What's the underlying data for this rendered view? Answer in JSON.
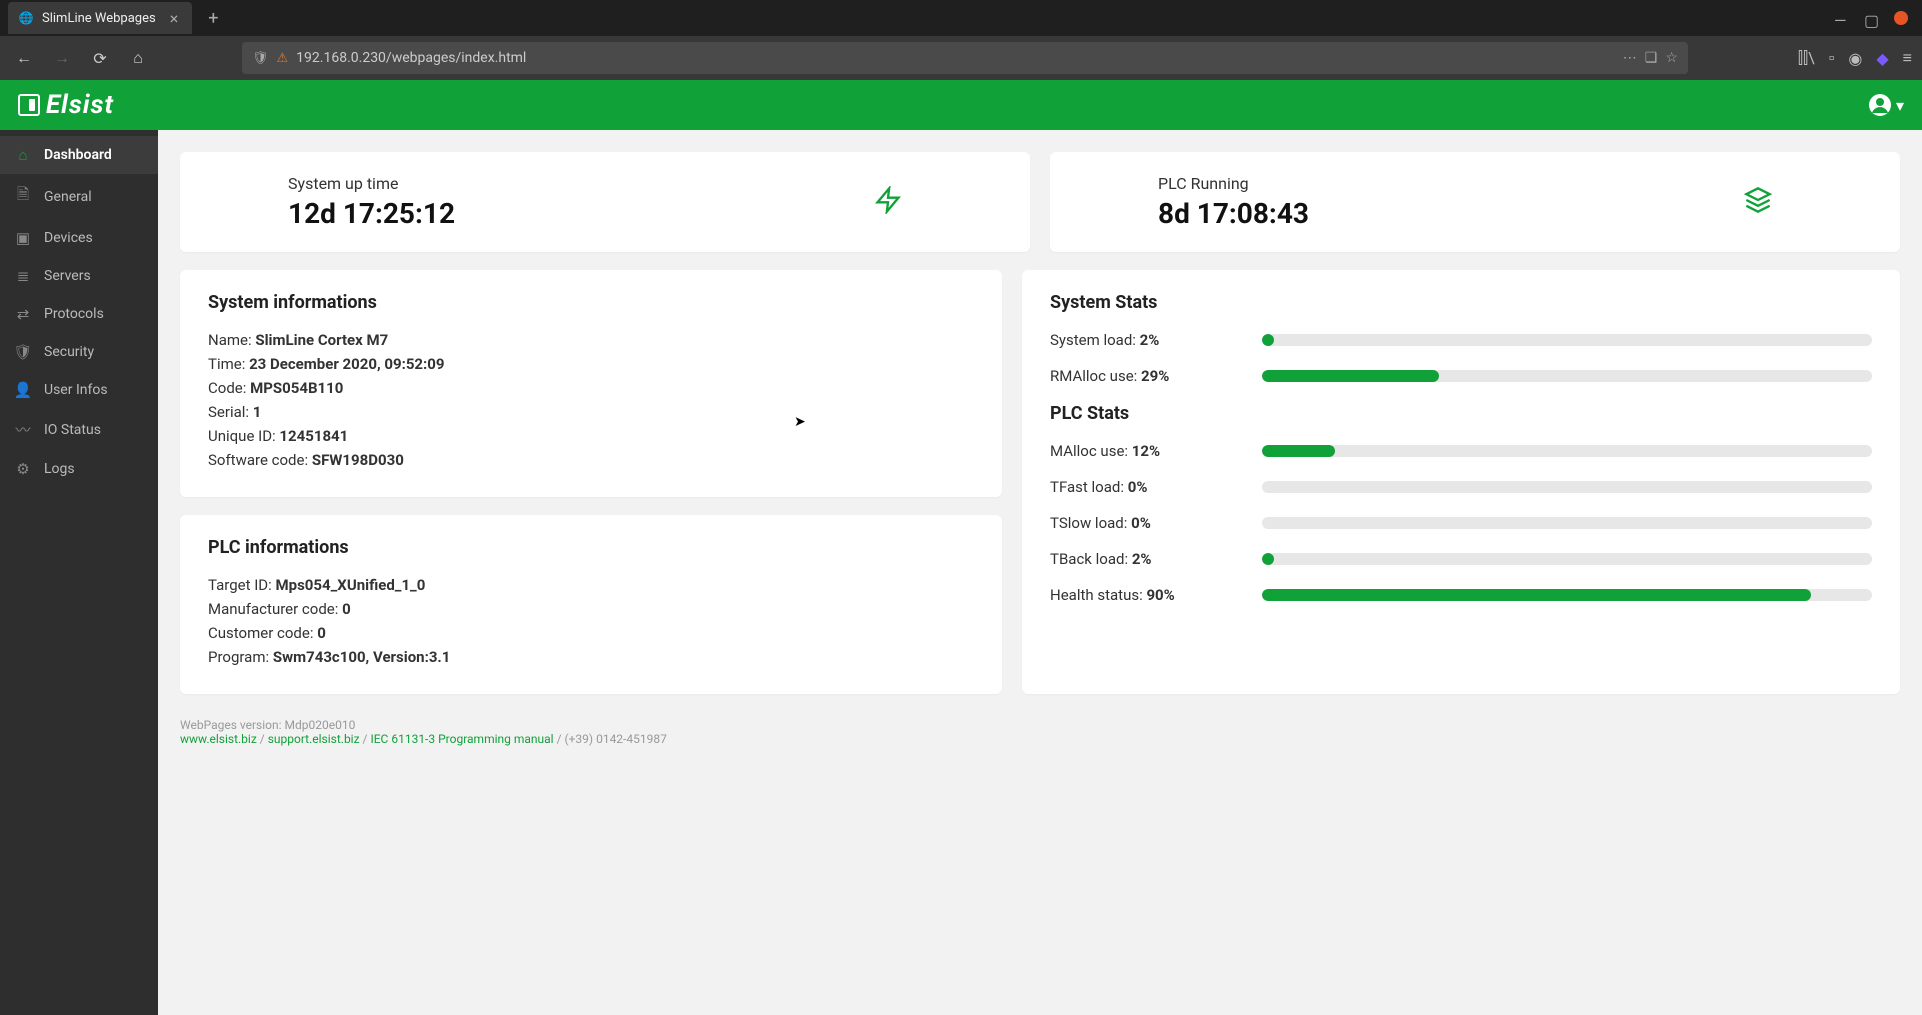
{
  "browser": {
    "tab_title": "SlimLine Webpages",
    "url": "192.168.0.230/webpages/index.html"
  },
  "header": {
    "brand": "Elsist"
  },
  "sidebar": {
    "items": [
      {
        "label": "Dashboard",
        "active": true
      },
      {
        "label": "General",
        "active": false
      },
      {
        "label": "Devices",
        "active": false
      },
      {
        "label": "Servers",
        "active": false
      },
      {
        "label": "Protocols",
        "active": false
      },
      {
        "label": "Security",
        "active": false
      },
      {
        "label": "User Infos",
        "active": false
      },
      {
        "label": "IO Status",
        "active": false
      },
      {
        "label": "Logs",
        "active": false
      }
    ]
  },
  "top_stats": {
    "uptime_label": "System up time",
    "uptime_value": "12d 17:25:12",
    "plc_label": "PLC Running",
    "plc_value": "8d 17:08:43"
  },
  "sys_info": {
    "title": "System informations",
    "name_label": "Name:",
    "name": "SlimLine Cortex M7",
    "time_label": "Time:",
    "time": "23 December 2020, 09:52:09",
    "code_label": "Code:",
    "code": "MPS054B110",
    "serial_label": "Serial:",
    "serial": "1",
    "uid_label": "Unique ID:",
    "uid": "12451841",
    "sw_label": "Software code:",
    "sw": "SFW198D030"
  },
  "plc_info": {
    "title": "PLC informations",
    "target_label": "Target ID:",
    "target": "Mps054_XUnified_1_0",
    "mfg_label": "Manufacturer code:",
    "mfg": "0",
    "cust_label": "Customer code:",
    "cust": "0",
    "prog_label": "Program:",
    "prog": "Swm743c100, Version:3.1"
  },
  "sys_stats": {
    "title": "System Stats",
    "sysload_label": "System load:",
    "sysload_pct": "2%",
    "sysload_width": "2%",
    "rmalloc_label": "RMAlloc use:",
    "rmalloc_pct": "29%",
    "rmalloc_width": "29%"
  },
  "plc_stats": {
    "title": "PLC Stats",
    "malloc_label": "MAlloc use:",
    "malloc_pct": "12%",
    "malloc_width": "12%",
    "tfast_label": "TFast load:",
    "tfast_pct": "0%",
    "tfast_width": "0%",
    "tslow_label": "TSlow load:",
    "tslow_pct": "0%",
    "tslow_width": "0%",
    "tback_label": "TBack load:",
    "tback_pct": "2%",
    "tback_width": "2%",
    "health_label": "Health status:",
    "health_pct": "90%",
    "health_width": "90%"
  },
  "footer": {
    "version": "WebPages version: Mdp020e010",
    "link1": "www.elsist.biz",
    "link2": "support.elsist.biz",
    "link3": "IEC 61131-3 Programming manual",
    "phone": "(+39) 0142-451987",
    "sep": " / "
  }
}
